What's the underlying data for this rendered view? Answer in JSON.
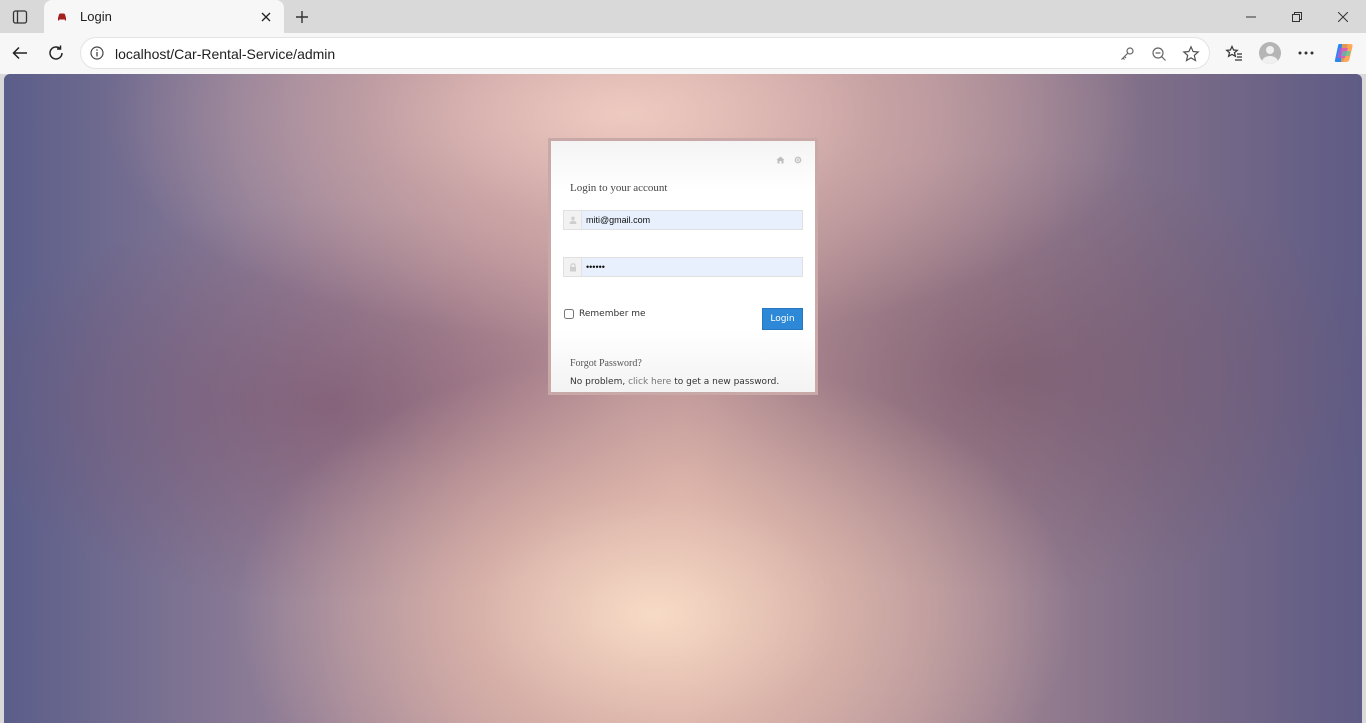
{
  "browser": {
    "tab": {
      "title": "Login",
      "favicon": "car-icon"
    },
    "address": {
      "url": "localhost/Car-Rental-Service/admin"
    }
  },
  "login": {
    "heading": "Login to your account",
    "email": {
      "value": "miti@gmail.com",
      "icon": "user-icon"
    },
    "password": {
      "value": "••••••",
      "icon": "lock-icon"
    },
    "remember_label": "Remember me",
    "remember_checked": false,
    "button_label": "Login",
    "forgot_title": "Forgot Password?",
    "forgot_prefix": "No problem,",
    "forgot_link": "click here",
    "forgot_suffix": "to get a new password."
  },
  "colors": {
    "login_button": "#2d89d7",
    "box_border": "#c9a8a8",
    "input_fill": "#e8f0fe"
  }
}
